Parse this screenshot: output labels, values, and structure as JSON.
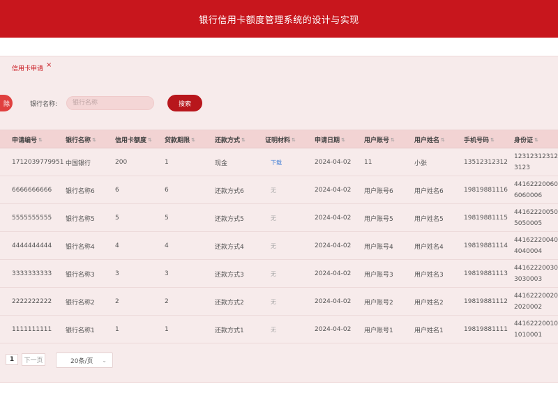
{
  "header": {
    "title": "银行信用卡额度管理系统的设计与实现"
  },
  "tabs": [
    {
      "label": "信用卡申请",
      "close": "×"
    }
  ],
  "toolbar": {
    "delete_label": "除"
  },
  "search": {
    "label": "银行名称:",
    "placeholder": "银行名称",
    "button": "搜索"
  },
  "table": {
    "columns": [
      "申请编号",
      "银行名称",
      "信用卡额度",
      "贷款期限",
      "还款方式",
      "证明材料",
      "申请日期",
      "用户账号",
      "用户姓名",
      "手机号码",
      "身份证"
    ],
    "sort_icon": "⇅",
    "rows": [
      {
        "id": "1712039779951",
        "bank": "中国银行",
        "limit": "200",
        "term": "1",
        "repay": "现金",
        "proof": "下载",
        "proof_type": "link",
        "date": "2024-04-02",
        "account": "11",
        "name": "小张",
        "phone": "13512312312",
        "idcard": "123123123123123"
      },
      {
        "id": "6666666666",
        "bank": "银行名称6",
        "limit": "6",
        "term": "6",
        "repay": "还款方式6",
        "proof": "无",
        "proof_type": "none",
        "date": "2024-04-02",
        "account": "用户账号6",
        "name": "用户姓名6",
        "phone": "19819881116",
        "idcard": "441622200606060006"
      },
      {
        "id": "5555555555",
        "bank": "银行名称5",
        "limit": "5",
        "term": "5",
        "repay": "还款方式5",
        "proof": "无",
        "proof_type": "none",
        "date": "2024-04-02",
        "account": "用户账号5",
        "name": "用户姓名5",
        "phone": "19819881115",
        "idcard": "441622200505050005"
      },
      {
        "id": "4444444444",
        "bank": "银行名称4",
        "limit": "4",
        "term": "4",
        "repay": "还款方式4",
        "proof": "无",
        "proof_type": "none",
        "date": "2024-04-02",
        "account": "用户账号4",
        "name": "用户姓名4",
        "phone": "19819881114",
        "idcard": "441622200404040004"
      },
      {
        "id": "3333333333",
        "bank": "银行名称3",
        "limit": "3",
        "term": "3",
        "repay": "还款方式3",
        "proof": "无",
        "proof_type": "none",
        "date": "2024-04-02",
        "account": "用户账号3",
        "name": "用户姓名3",
        "phone": "19819881113",
        "idcard": "441622200303030003"
      },
      {
        "id": "2222222222",
        "bank": "银行名称2",
        "limit": "2",
        "term": "2",
        "repay": "还款方式2",
        "proof": "无",
        "proof_type": "none",
        "date": "2024-04-02",
        "account": "用户账号2",
        "name": "用户姓名2",
        "phone": "19819881112",
        "idcard": "441622200202020002"
      },
      {
        "id": "1111111111",
        "bank": "银行名称1",
        "limit": "1",
        "term": "1",
        "repay": "还款方式1",
        "proof": "无",
        "proof_type": "none",
        "date": "2024-04-02",
        "account": "用户账号1",
        "name": "用户姓名1",
        "phone": "19819881111",
        "idcard": "441622200101010001"
      }
    ]
  },
  "pagination": {
    "current_page": "1",
    "next_label": "下一页",
    "page_size": "20条/页",
    "chevron": "⌄"
  },
  "colors": {
    "brand": "#c8161d",
    "content_bg": "#f7ebeb",
    "header_row_bg": "#f2d3d3",
    "link": "#3a7bd5"
  },
  "icons": {
    "tab_close": "close-icon",
    "sort": "sort-icon",
    "dropdown": "chevron-down-icon"
  }
}
